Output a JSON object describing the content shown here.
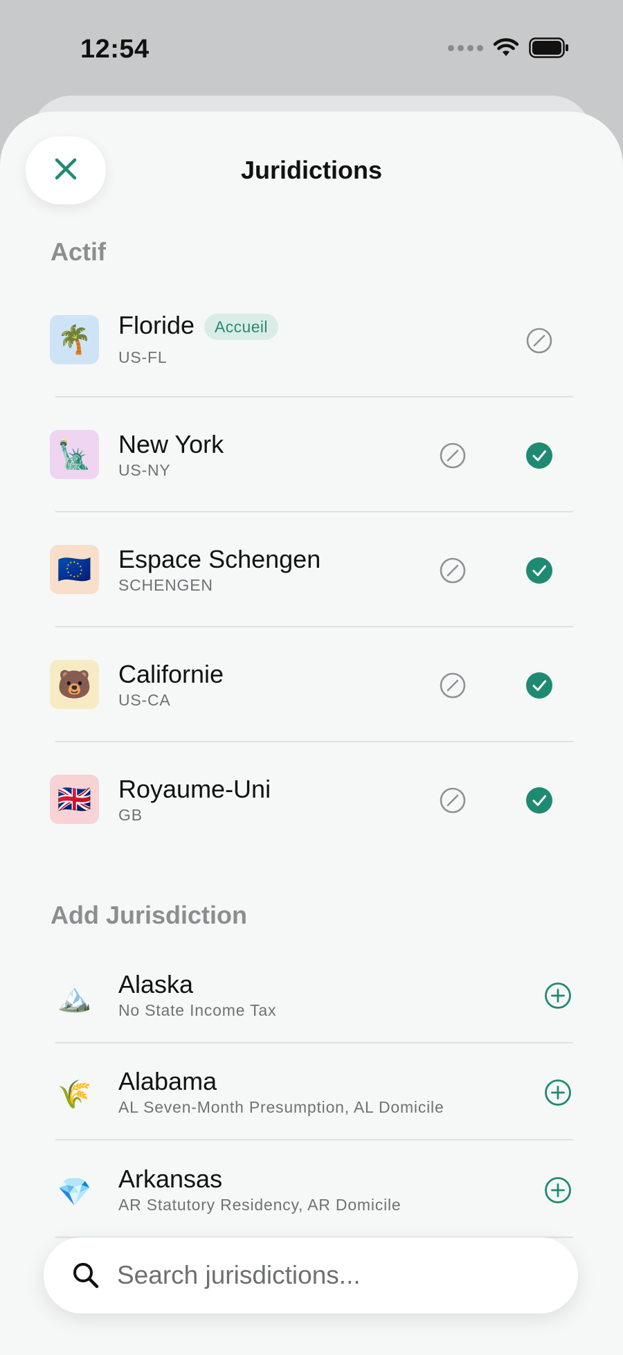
{
  "status_bar": {
    "time": "12:54"
  },
  "header": {
    "title": "Juridictions",
    "close_icon": "close-icon"
  },
  "colors": {
    "accent": "#1f8a72",
    "muted": "#8b8d8f",
    "badge_bg": "#d9ece6"
  },
  "active_section": {
    "heading": "Actif",
    "items": [
      {
        "name": "Floride",
        "code": "US-FL",
        "emoji": "🌴",
        "icon_bg": "#cfe3f7",
        "badge": "Accueil",
        "checked": false
      },
      {
        "name": "New York",
        "code": "US-NY",
        "emoji": "🗽",
        "icon_bg": "#efd5f1",
        "checked": true
      },
      {
        "name": "Espace Schengen",
        "code": "SCHENGEN",
        "emoji": "🇪🇺",
        "icon_bg": "#f8dfcb",
        "checked": true
      },
      {
        "name": "Californie",
        "code": "US-CA",
        "emoji": "🐻",
        "icon_bg": "#f7ebc3",
        "checked": true
      },
      {
        "name": "Royaume-Uni",
        "code": "GB",
        "emoji": "🇬🇧",
        "icon_bg": "#f7d3d6",
        "checked": true
      }
    ]
  },
  "add_section": {
    "heading": "Add Jurisdiction",
    "items": [
      {
        "name": "Alaska",
        "detail": "No State Income Tax",
        "emoji": "🏔️"
      },
      {
        "name": "Alabama",
        "detail": "AL Seven-Month Presumption, AL Domicile",
        "emoji": "🌾"
      },
      {
        "name": "Arkansas",
        "detail": "AR Statutory Residency, AR Domicile",
        "emoji": "💎"
      }
    ]
  },
  "search": {
    "placeholder": "Search jurisdictions..."
  }
}
